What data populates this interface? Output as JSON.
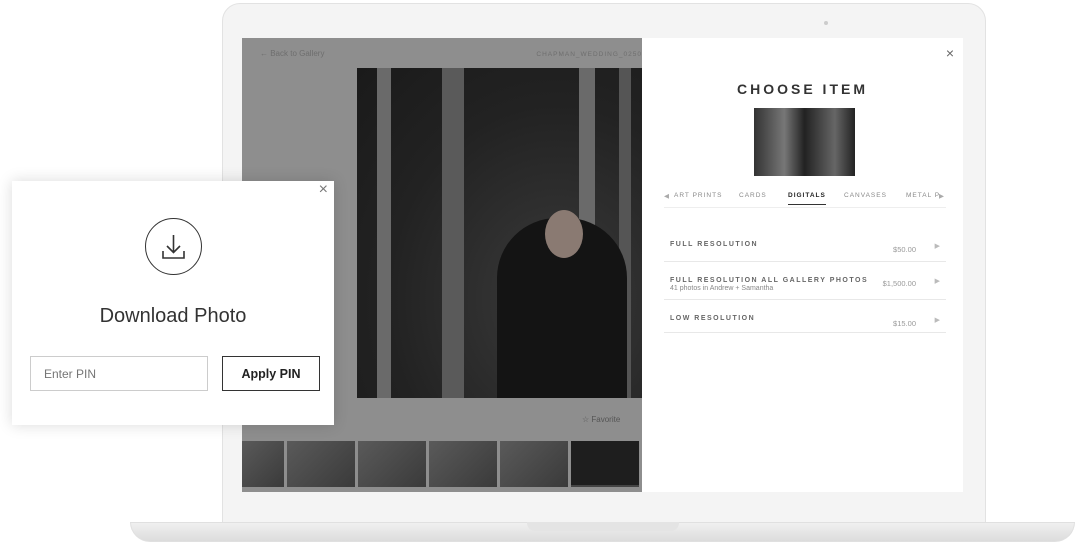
{
  "gallery": {
    "back_label": "← Back to Gallery",
    "filename": "CHAPMAN_WEDDING_0250",
    "favorite_label": "☆ Favorite"
  },
  "panel": {
    "title": "CHOOSE ITEM",
    "close": "×",
    "tabs": [
      {
        "label": "ART PRINTS"
      },
      {
        "label": "CARDS"
      },
      {
        "label": "DIGITALS",
        "active": true
      },
      {
        "label": "CANVASES"
      },
      {
        "label": "METAL P"
      }
    ],
    "tab_prev": "◀",
    "tab_next": "▶",
    "items": [
      {
        "label": "FULL RESOLUTION",
        "sub": "",
        "price": "$50.00"
      },
      {
        "label": "FULL RESOLUTION ALL GALLERY PHOTOS",
        "sub": "41 photos in Andrew + Samantha",
        "price": "$1,500.00"
      },
      {
        "label": "LOW RESOLUTION",
        "sub": "",
        "price": "$15.00"
      }
    ],
    "arrow": "▶"
  },
  "download": {
    "title": "Download Photo",
    "close": "×",
    "pin_placeholder": "Enter PIN",
    "apply_label": "Apply PIN",
    "icon": "download-icon"
  }
}
